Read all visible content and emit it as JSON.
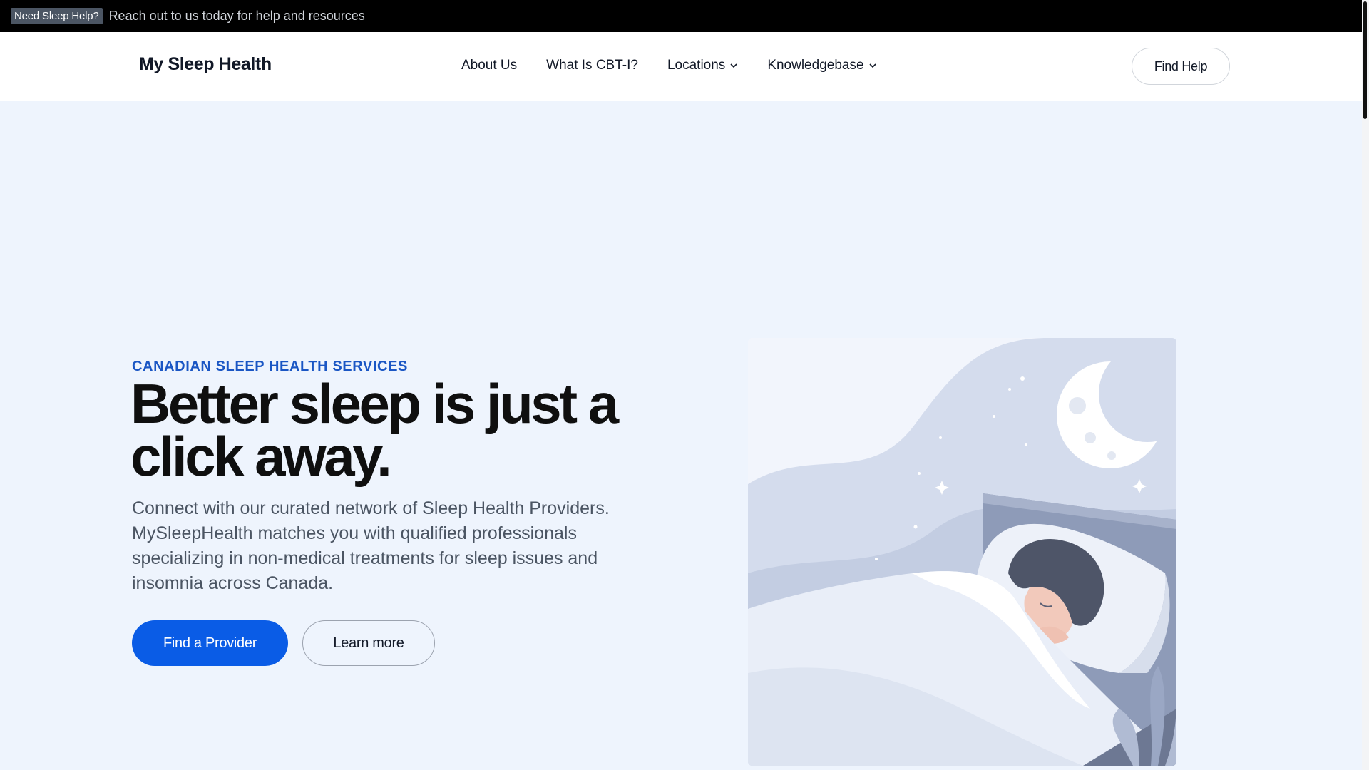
{
  "announcement": {
    "badge": "Need Sleep Help?",
    "message": "Reach out to us today for help and resources"
  },
  "header": {
    "logo": "My Sleep Health",
    "nav": [
      {
        "label": "About Us"
      },
      {
        "label": "What Is CBT-I?"
      },
      {
        "label": "Locations"
      },
      {
        "label": "Knowledgebase"
      }
    ],
    "cta": "Find Help"
  },
  "hero": {
    "eyebrow": "CANADIAN SLEEP HEALTH SERVICES",
    "headline": "Better sleep is just a click away.",
    "description": "Connect with our curated network of Sleep Health Providers. MySleepHealth matches you with qualified professionals specializing in non-medical treatments for sleep issues and insomnia across Canada.",
    "primary_button": "Find a Provider",
    "secondary_button": "Learn more"
  },
  "colors": {
    "accent": "#0a5ce6",
    "eyebrow": "#1a56c4",
    "hero_bg": "#eef4fd",
    "announce_bg": "#000000"
  },
  "icons": {
    "dropdown": "chevron-down-icon",
    "illustration": "sleeping-woman-illustration"
  }
}
